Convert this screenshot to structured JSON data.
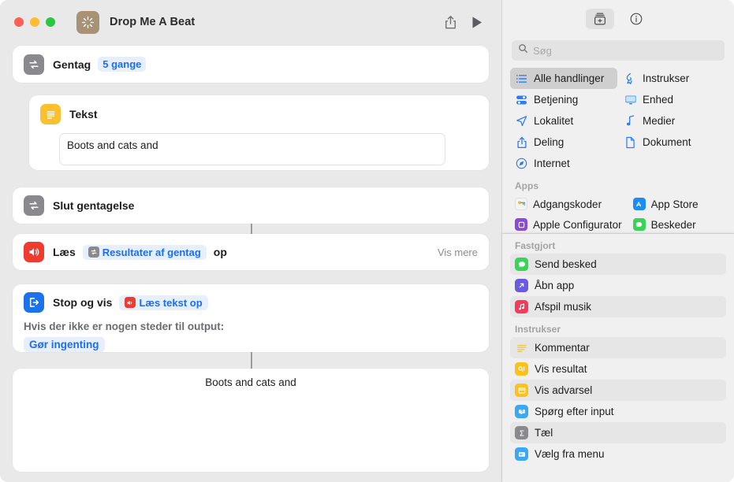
{
  "window": {
    "app_icon": "sparkle-icon",
    "traffic_lights": [
      "close",
      "minimize",
      "zoom"
    ],
    "title": "Drop Me A Beat",
    "toolbar": {
      "share_label": "share-icon",
      "play_label": "play-icon"
    }
  },
  "workflow": {
    "repeat": {
      "icon": "repeat-icon",
      "title": "Gentag",
      "count_chip": "5 gange"
    },
    "text": {
      "icon": "text-icon",
      "title": "Tekst",
      "field_value": "Boots and cats and"
    },
    "end_repeat": {
      "icon": "repeat-icon",
      "title": "Slut gentagelse"
    },
    "speak": {
      "icon": "speaker-icon",
      "title": "Læs",
      "token": "Resultater af gentag",
      "token_icon": "repeat-icon",
      "suffix": "op",
      "show_more": "Vis mere"
    },
    "stop": {
      "icon": "stop-and-output-icon",
      "title": "Stop og vis",
      "token": "Læs tekst op",
      "token_icon": "speaker-icon",
      "subtitle": "Hvis der ikke er nogen steder til output:",
      "option": "Gør ingenting"
    },
    "output_preview": {
      "text": "Boots and cats and"
    }
  },
  "library": {
    "toolbar": {
      "library_button": "action-library-icon",
      "info_button": "info-circle-icon"
    },
    "search": {
      "icon": "search-icon",
      "placeholder": "Søg",
      "value": ""
    },
    "categories": [
      {
        "label": "Alle handlinger",
        "icon": "list-bullet-icon",
        "selected": true
      },
      {
        "label": "Instrukser",
        "icon": "ribbon-icon",
        "selected": false
      },
      {
        "label": "Betjening",
        "icon": "sliders-icon",
        "selected": false
      },
      {
        "label": "Enhed",
        "icon": "display-icon",
        "selected": false
      },
      {
        "label": "Lokalitet",
        "icon": "location-arrow-icon",
        "selected": false
      },
      {
        "label": "Medier",
        "icon": "music-note-icon",
        "selected": false
      },
      {
        "label": "Deling",
        "icon": "share-up-icon",
        "selected": false
      },
      {
        "label": "Dokument",
        "icon": "document-icon",
        "selected": false
      },
      {
        "label": "Internet",
        "icon": "safari-compass-icon",
        "selected": false
      }
    ],
    "apps_section": {
      "heading": "Apps",
      "items": [
        {
          "label": "Adgangskoder",
          "icon": "passwords-app-icon",
          "color": "#f2f2f2"
        },
        {
          "label": "App Store",
          "icon": "app-store-icon",
          "color": "#1b8cf5"
        },
        {
          "label": "Apple Configurator",
          "icon": "apple-configurator-icon",
          "color": "#8a4ad8"
        },
        {
          "label": "Beskeder",
          "icon": "messages-app-icon",
          "color": "#3ad35a"
        }
      ]
    },
    "pinned_section": {
      "heading": "Fastgjort",
      "items": [
        {
          "label": "Send besked",
          "icon": "messages-app-icon",
          "color": "#3ad35a",
          "alt": true
        },
        {
          "label": "Åbn app",
          "icon": "open-app-icon",
          "color": "#6a5ae0",
          "alt": false
        },
        {
          "label": "Afspil musik",
          "icon": "music-app-icon",
          "color": "#f9395c",
          "alt": true
        }
      ]
    },
    "instructions_section": {
      "heading": "Instrukser",
      "items": [
        {
          "label": "Kommentar",
          "icon": "comment-icon",
          "color": "#ffffff",
          "alt": true
        },
        {
          "label": "Vis resultat",
          "icon": "show-result-icon",
          "color": "#fcc21b",
          "alt": false
        },
        {
          "label": "Vis advarsel",
          "icon": "show-alert-icon",
          "color": "#fcc21b",
          "alt": true
        },
        {
          "label": "Spørg efter input",
          "icon": "ask-for-input-icon",
          "color": "#3aa8f5",
          "alt": false
        },
        {
          "label": "Tæl",
          "icon": "count-sigma-icon",
          "color": "#8a8a8e",
          "alt": true
        },
        {
          "label": "Vælg fra menu",
          "icon": "choose-from-menu-icon",
          "color": "#3aa8f5",
          "alt": false
        }
      ]
    }
  }
}
